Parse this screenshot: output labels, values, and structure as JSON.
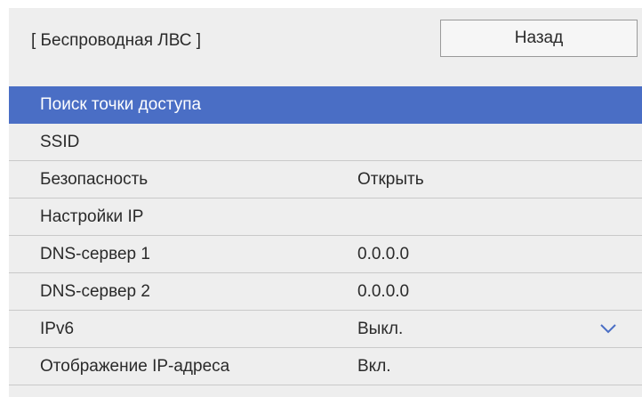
{
  "header": {
    "title": "[ Беспроводная ЛВС ]",
    "back_label": "Назад"
  },
  "menu": {
    "items": [
      {
        "label": "Поиск точки доступа",
        "value": "",
        "selected": true
      },
      {
        "label": "SSID",
        "value": ""
      },
      {
        "label": "Безопасность",
        "value": "Открыть"
      },
      {
        "label": "Настройки IP",
        "value": ""
      },
      {
        "label": "DNS-сервер 1",
        "value": "0.0.0.0"
      },
      {
        "label": "DNS-сервер 2",
        "value": "0.0.0.0"
      },
      {
        "label": "IPv6",
        "value": "Выкл.",
        "icon": "chevron-down-icon"
      },
      {
        "label": "Отображение IP-адреса",
        "value": "Вкл."
      }
    ]
  },
  "colors": {
    "selected_row": "#4a6ec5",
    "panel_background": "#eeeeee",
    "chevron": "#4a6ec5"
  }
}
